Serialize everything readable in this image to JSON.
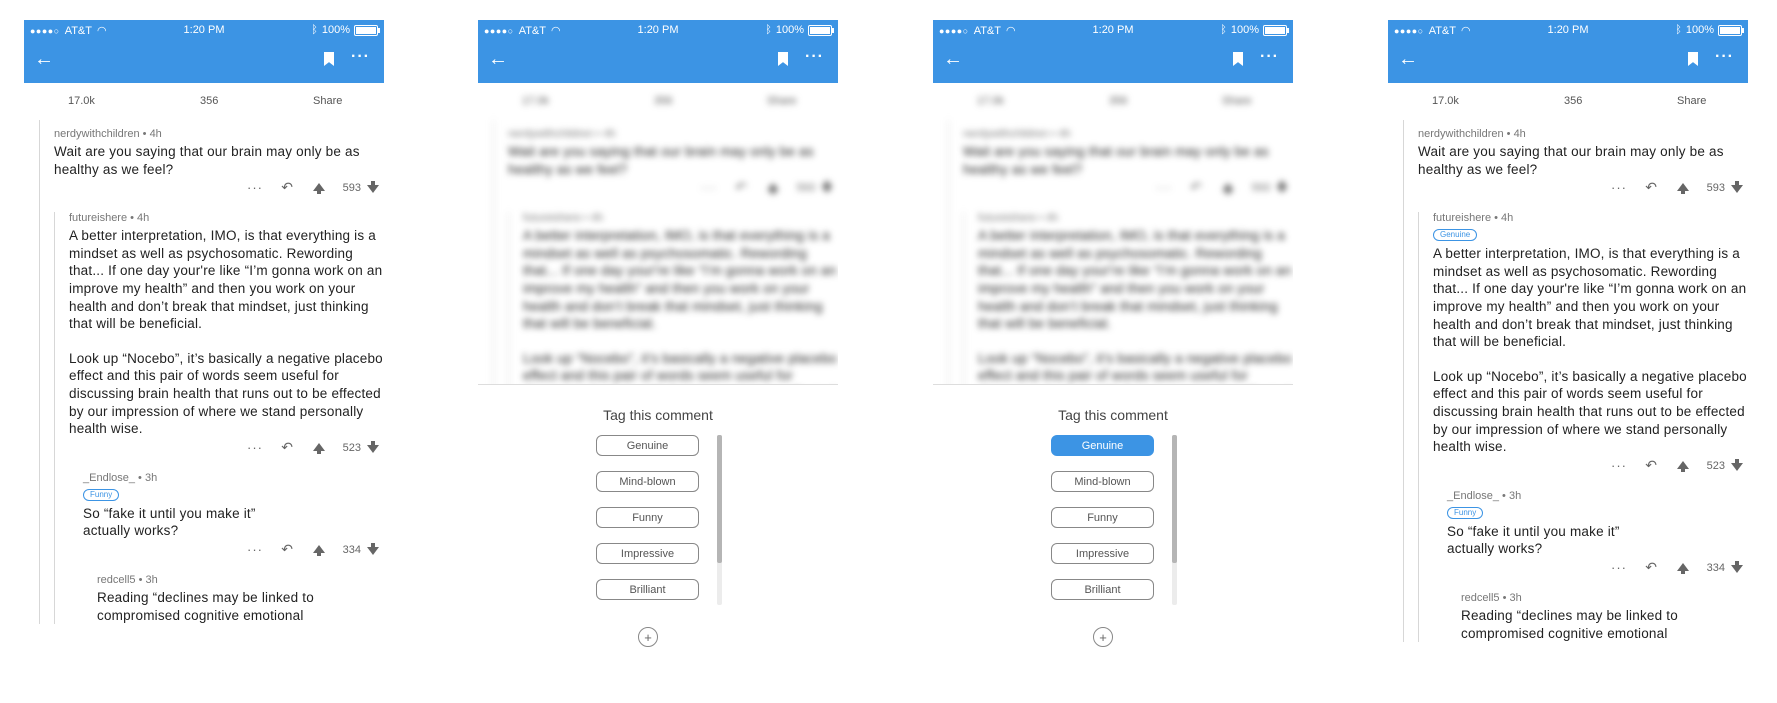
{
  "status": {
    "carrier": "AT&T",
    "time": "1:20 PM",
    "battery": "100%"
  },
  "stats": {
    "upvotes": "17.0k",
    "comments": "356",
    "share": "Share"
  },
  "comments": [
    {
      "user": "nerdywithchildren • 4h",
      "text": "Wait are you saying that our brain may only be as healthy as we feel?",
      "score": "593"
    },
    {
      "user": "futureishere • 4h",
      "tag": "Genuine",
      "p1": "A better interpretation, IMO, is that everything is a mindset as well as psychosomatic. Rewording that... If one day your're like “I’m gonna work on an improve my health” and then you work on your health and don’t break that mindset, just thinking that will be beneficial.",
      "p2": "Look up “Nocebo”, it’s basically a negative placebo effect and this pair of words seem useful for discussing brain health that runs out to be effected by our impression of where we stand personally health wise.",
      "score": "523"
    },
    {
      "user": "_Endlose_ • 3h",
      "tag": "Funny",
      "text": "So “fake it until you make it” actually works?",
      "score": "334"
    },
    {
      "user": "redcell5 • 3h",
      "text": "Reading “declines may be linked to compromised cognitive emotional"
    }
  ],
  "sheet": {
    "title": "Tag this comment",
    "tags": [
      "Genuine",
      "Mind-blown",
      "Funny",
      "Impressive",
      "Brilliant"
    ],
    "selected_in_screen3": "Genuine"
  },
  "colors": {
    "accent": "#3c94e4"
  },
  "icons": [
    "back-arrow-icon",
    "bookmark-icon",
    "more-icon",
    "reply-icon",
    "upvote-icon",
    "downvote-icon",
    "add-icon",
    "wifi-icon",
    "bluetooth-icon",
    "battery-icon"
  ]
}
